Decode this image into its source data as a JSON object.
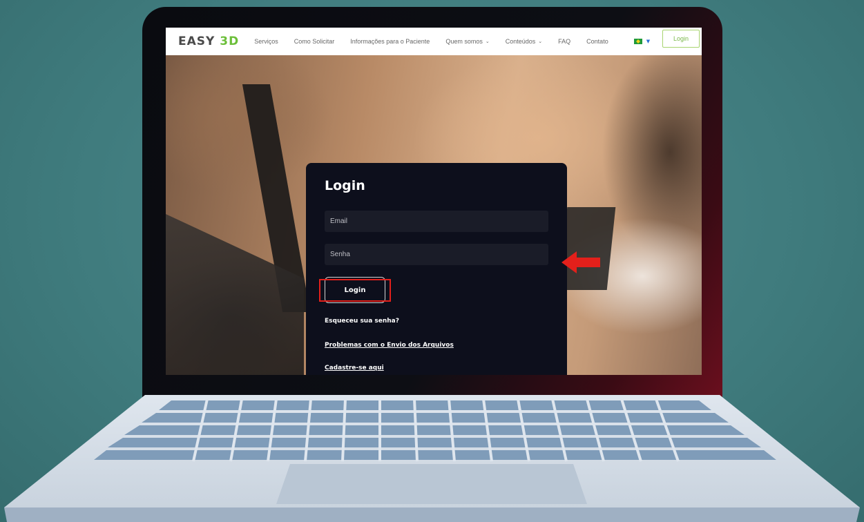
{
  "nav": {
    "logo_prefix": "EASY ",
    "logo_accent": "3D",
    "items": [
      {
        "label": "Serviços",
        "dropdown": false
      },
      {
        "label": "Como Solicitar",
        "dropdown": false
      },
      {
        "label": "Informações para o Paciente",
        "dropdown": false
      },
      {
        "label": "Quem somos",
        "dropdown": true
      },
      {
        "label": "Conteúdos",
        "dropdown": true
      },
      {
        "label": "FAQ",
        "dropdown": false
      },
      {
        "label": "Contato",
        "dropdown": false
      }
    ],
    "chevron_glyph": "⌄",
    "flag_caret": "▼",
    "login_label": "Login"
  },
  "login_card": {
    "title": "Login",
    "email_placeholder": "Email",
    "password_placeholder": "Senha",
    "login_button": "Login",
    "forgot_password": "Esqueceu sua senha?",
    "file_upload_problems": "Problemas com o Envio dos Arquivos",
    "register": "Cadastre-se aqui"
  },
  "colors": {
    "brand_green": "#6cbf3a",
    "card_bg": "#0d0f1c",
    "highlight_red": "#e3201b",
    "background_teal": "#3f7b7d"
  }
}
